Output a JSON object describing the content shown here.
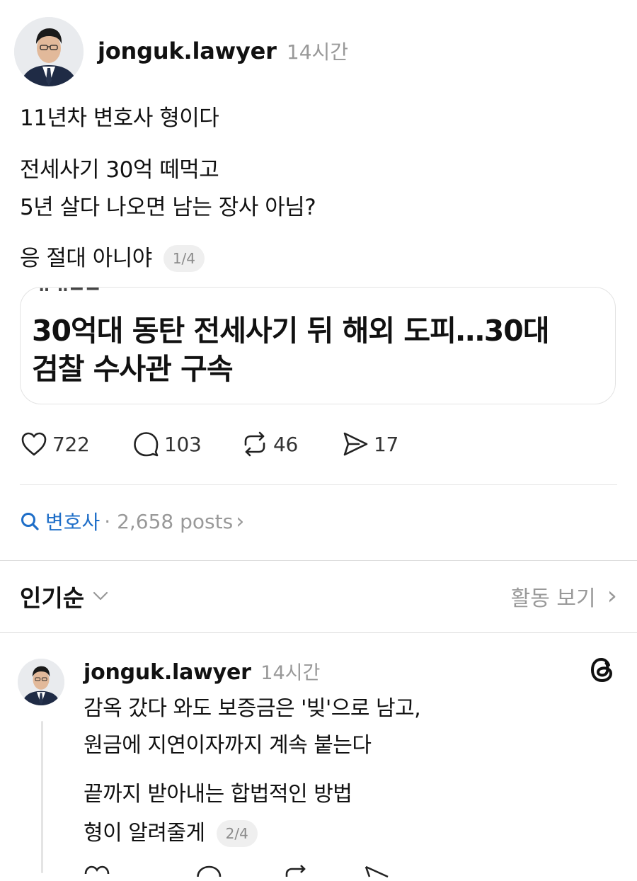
{
  "post": {
    "username": "jonguk.lawyer",
    "timestamp": "14시간",
    "lines": [
      "11년차 변호사 형이다",
      "전세사기 30억 떼먹고",
      "5년 살다 나오면 남는 장사 아님?",
      "응 절대 아니야"
    ],
    "pager": "1/4",
    "link_card": {
      "title_line1": "30억대 동탄 전세사기 뒤 해외 도피…30대",
      "title_line2": "검찰 수사관 구속"
    },
    "actions": {
      "likes": "722",
      "comments": "103",
      "reposts": "46",
      "shares": "17"
    }
  },
  "topic": {
    "name": "변호사",
    "meta": "· 2,658 posts",
    "chevron": "›"
  },
  "sort": {
    "label": "인기순",
    "activity_label": "활동 보기",
    "chevron": "›"
  },
  "reply": {
    "username": "jonguk.lawyer",
    "timestamp": "14시간",
    "lines": [
      "감옥 갔다 와도 보증금은 '빚'으로 남고,",
      "원금에 지연이자까지 계속 붙는다",
      "끝까지 받아내는 합법적인 방법",
      "형이 알려줄게"
    ],
    "pager": "2/4"
  },
  "icons": {
    "like": "heart-icon",
    "comment": "comment-bubble-icon",
    "repost": "repost-icon",
    "share": "send-icon",
    "search": "search-icon",
    "threads": "threads-logo-icon",
    "chevron_down": "chevron-down-icon"
  },
  "colors": {
    "link_blue": "#1e6ec8",
    "muted": "#999999"
  }
}
